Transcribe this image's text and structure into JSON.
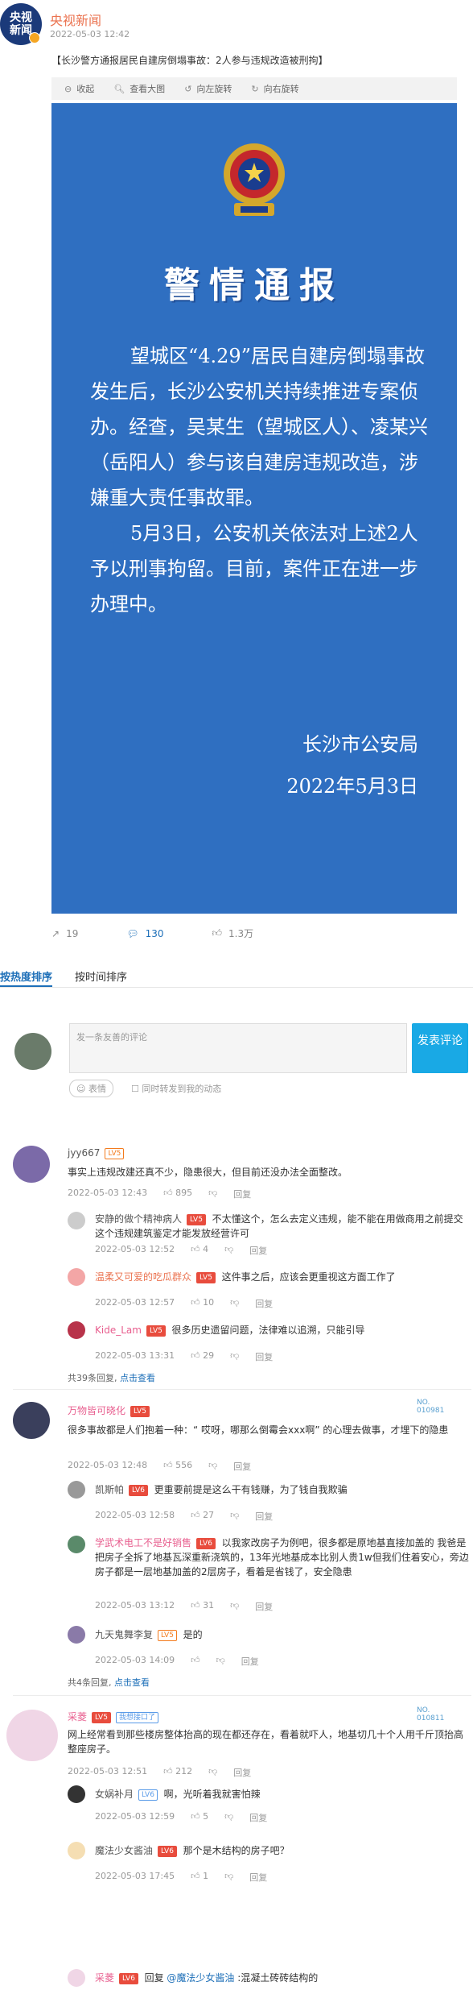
{
  "post": {
    "author": "央视新闻",
    "avatar_text_1": "央视",
    "avatar_text_2": "新闻",
    "time": "2022-05-03 12:42",
    "text": "【长沙警方通报居民自建房倒塌事故：2人参与违规改造被刑拘】"
  },
  "image_toolbar": {
    "collapse": "收起",
    "view_large": "查看大图",
    "rotate_left": "向左旋转",
    "rotate_right": "向右旋转"
  },
  "notice": {
    "title": "警情通报",
    "paragraph_1": "望城区“4.29”居民自建房倒塌事故发生后，长沙公安机关持续推进专案侦办。经查，吴某生（望城区人）、凌某兴（岳阳人）参与该自建房违规改造，涉嫌重大责任事故罪。",
    "paragraph_2": "5月3日，公安机关依法对上述2人予以刑事拘留。目前，案件正在进一步办理中。",
    "issuer": "长沙市公安局",
    "date": "2022年5月3日"
  },
  "actions": {
    "reposts": "19",
    "comments": "130",
    "likes": "1.3万"
  },
  "sort_tabs": {
    "hot": "按热度排序",
    "time": "按时间排序"
  },
  "compose": {
    "placeholder": "发一条友善的评论",
    "send": "发表评论",
    "emoji": "表情",
    "also_post": "同时转发到我的动态"
  },
  "comments": [
    {
      "name": "jyy667",
      "level": "LV5",
      "text": "事实上违规改建还真不少，隐患很大，但目前还没办法全面整改。",
      "time": "2022-05-03 12:43",
      "likes": "895",
      "reply_label": "回复",
      "replies": [
        {
          "name": "安静的做个精神病人",
          "level": "LV5",
          "text": "不太懂这个，怎么去定义违规，能不能在用做商用之前提交这个违规建筑鉴定才能发放经营许可",
          "time": "2022-05-03 12:52",
          "likes": "4",
          "reply_label": "回复"
        },
        {
          "name": "温柔又可爱的吃瓜群众",
          "level": "LV5",
          "text": "这件事之后，应该会更重视这方面工作了",
          "time": "2022-05-03 12:57",
          "likes": "10",
          "reply_label": "回复"
        },
        {
          "name": "Kide_Lam",
          "level": "LV5",
          "text": "很多历史遗留问题，法律难以追溯，只能引导",
          "time": "2022-05-03 13:31",
          "likes": "29",
          "reply_label": "回复"
        }
      ],
      "more_prefix": "共",
      "more_count": "39",
      "more_suffix": "条回复,",
      "more_link": "点击查看"
    },
    {
      "name": "万物皆可晓化",
      "level": "LV5",
      "fan_label": "NO.",
      "fan_no": "010981",
      "text": "很多事故都是人们抱着一种：“ 哎呀，哪那么倒霉会xxx啊” 的心理去做事，才埋下的隐患",
      "time": "2022-05-03 12:48",
      "likes": "556",
      "reply_label": "回复",
      "replies": [
        {
          "name": "凯斯帕",
          "level": "LV6",
          "text": "更重要前提是这么干有钱赚，为了钱自我欺骗",
          "time": "2022-05-03 12:58",
          "likes": "27",
          "reply_label": "回复"
        },
        {
          "name": "学武术电工不是好销售",
          "level": "LV6",
          "text": "以我家改房子为例吧，很多都是原地基直接加盖的 我爸是把房子全拆了地基瓦深重新浇筑的，13年光地基成本比别人贵1w但我们住着安心，旁边房子都是一层地基加盖的2层房子，看着是省钱了，安全隐患",
          "time": "2022-05-03 13:12",
          "likes": "31",
          "reply_label": "回复"
        },
        {
          "name": "九天鬼舞李复",
          "level": "LV5",
          "text": "是的",
          "time": "2022-05-03 14:09",
          "likes": "",
          "reply_label": "回复"
        }
      ],
      "more_prefix": "共",
      "more_count": "4",
      "more_suffix": "条回复,",
      "more_link": "点击查看"
    },
    {
      "name": "采菱",
      "level": "LV5",
      "tag": "我想接口了",
      "fan_label": "NO.",
      "fan_no": "010811",
      "text": "网上经常看到那些楼房整体抬高的现在都还存在，看着就吓人，地基切几十个人用千斤顶抬高整座房子。",
      "time": "2022-05-03 12:51",
      "likes": "212",
      "reply_label": "回复",
      "replies": [
        {
          "name": "女娲补月",
          "level": "LV6",
          "text": "啊，光听着我就害怕辣",
          "time": "2022-05-03 12:59",
          "likes": "5",
          "reply_label": "回复"
        },
        {
          "name": "魔法少女酱油",
          "level": "LV6",
          "text": "那个是木结构的房子吧？",
          "time": "2022-05-03 17:45",
          "likes": "1",
          "reply_label": "回复"
        },
        {
          "name": "采菱",
          "level": "LV6",
          "text_prefix": "回复 ",
          "mention": "@魔法少女酱油",
          "text": " :混凝土砖砖结构的",
          "time": "",
          "likes": "",
          "reply_label": ""
        }
      ]
    }
  ],
  "colors": {
    "accent": "#1d6fb8",
    "notice_bg": "#2f6fc1",
    "author": "#eb7350",
    "send_button": "#19a9e5"
  }
}
